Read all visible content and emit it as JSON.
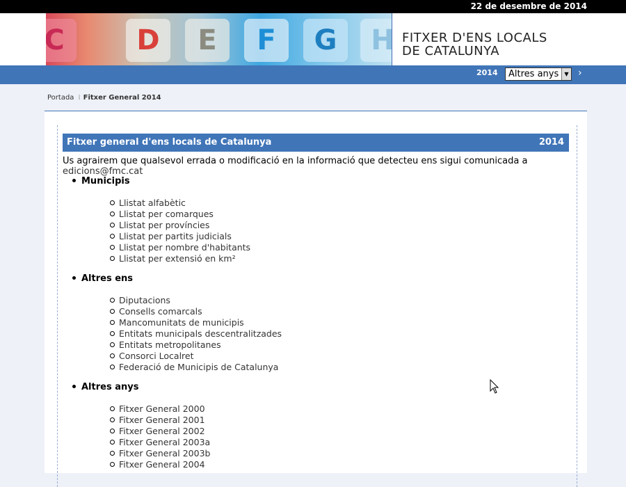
{
  "topbar": {
    "date": "22 de desembre de 2014"
  },
  "header": {
    "banner_letters": [
      "C",
      "D",
      "E",
      "F",
      "G",
      "H"
    ],
    "title_line1": "FITXER D'ENS LOCALS",
    "title_line2": "DE CATALUNYA"
  },
  "navbar": {
    "year": "2014",
    "select_value": "Altres anys",
    "go_icon": "chevron-right-icon"
  },
  "breadcrumb": {
    "home": "Portada",
    "current": "Fitxer General 2014"
  },
  "content": {
    "header_title": "Fitxer general d'ens locals de Catalunya",
    "header_year": "2014",
    "intro_text": "Us agrairem que qualsevol errada o modificació en la informació que detecteu ens sigui comunicada a",
    "intro_email": "edicions@fmc.cat",
    "sections": [
      {
        "title": "Municipis",
        "items": [
          "Llistat alfabètic",
          "Llistat per comarques",
          "Llistat per províncies",
          "Llistat per partits judicials",
          "Llistat per nombre d'habitants",
          "Llistat per extensió en km²"
        ]
      },
      {
        "title": "Altres ens",
        "items": [
          "Diputacions",
          "Consells comarcals",
          "Mancomunitats de municipis",
          "Entitats municipals descentralitzades",
          "Entitats metropolitanes",
          "Consorci Localret",
          "Federació de Municipis de Catalunya"
        ]
      },
      {
        "title": "Altres anys",
        "items": [
          "Fitxer General 2000",
          "Fitxer General 2001",
          "Fitxer General 2002",
          "Fitxer General 2003a",
          "Fitxer General 2003b",
          "Fitxer General 2004"
        ]
      }
    ]
  }
}
